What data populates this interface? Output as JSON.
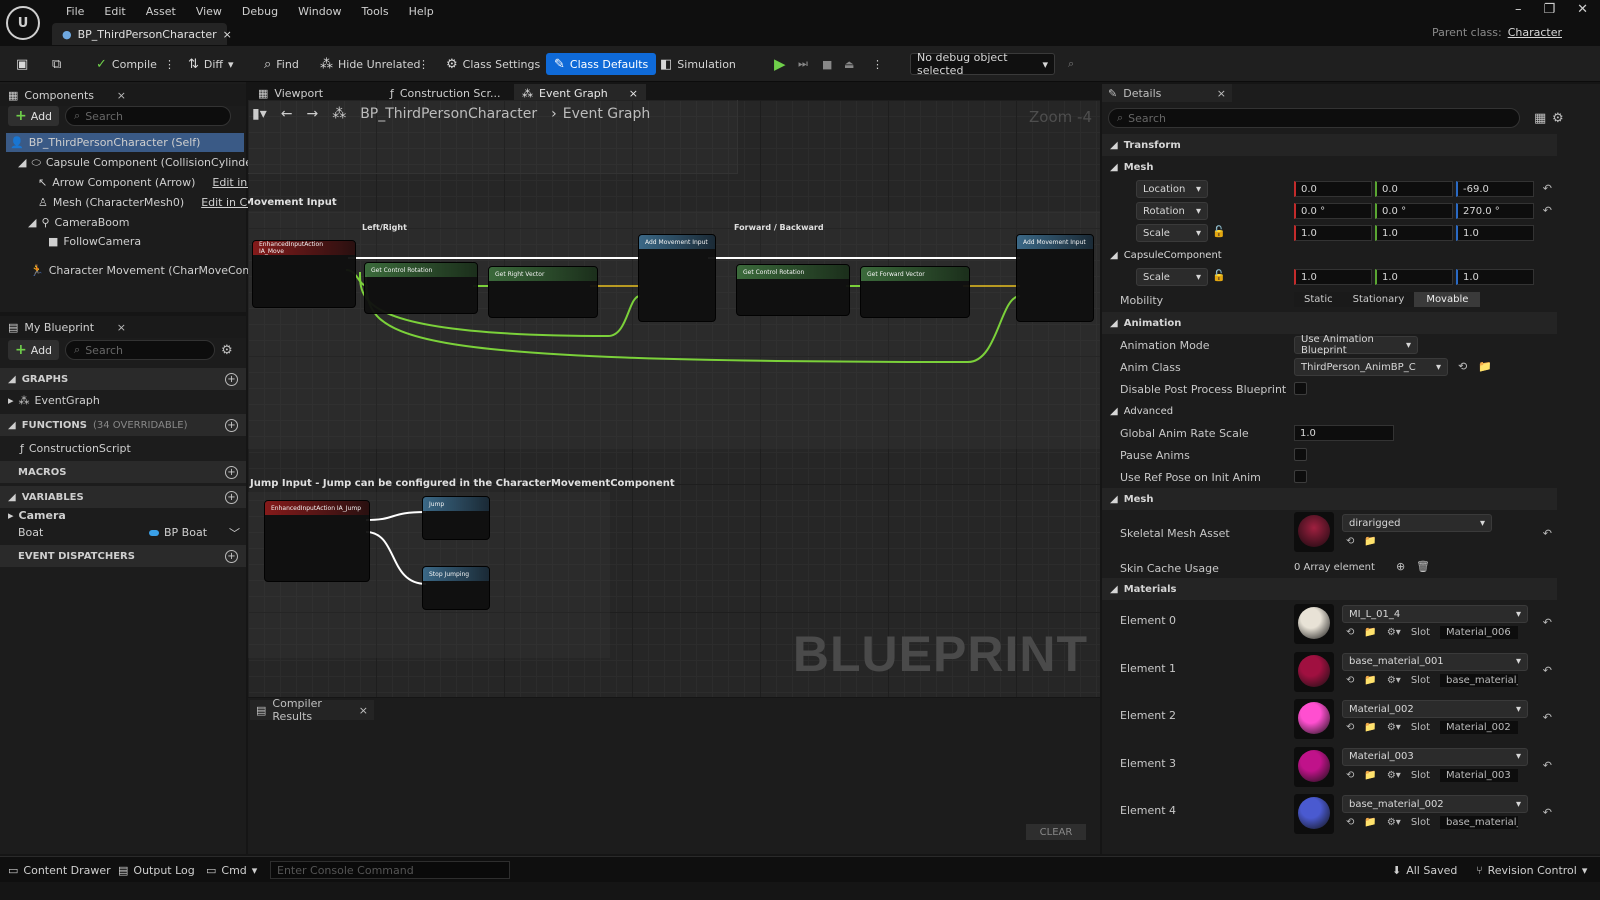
{
  "menu": [
    "File",
    "Edit",
    "Asset",
    "View",
    "Debug",
    "Window",
    "Tools",
    "Help"
  ],
  "doc_tab": "BP_ThirdPersonCharacter",
  "parent_class": {
    "label": "Parent class:",
    "value": "Character"
  },
  "toolbar": {
    "compile": "Compile",
    "diff": "Diff",
    "find": "Find",
    "hide_unrelated": "Hide Unrelated",
    "class_settings": "Class Settings",
    "class_defaults": "Class Defaults",
    "simulation": "Simulation",
    "debug_object": "No debug object selected"
  },
  "components": {
    "title": "Components",
    "add": "Add",
    "search_placeholder": "Search",
    "items": [
      "BP_ThirdPersonCharacter (Self)",
      "Capsule Component (CollisionCylinder)",
      "Arrow Component (Arrow)",
      "Mesh (CharacterMesh0)",
      "CameraBoom",
      "FollowCamera",
      "Character Movement (CharMoveComp)"
    ],
    "edit_cpp": "Edit in C++"
  },
  "my_blueprint": {
    "title": "My Blueprint",
    "add": "Add",
    "search_placeholder": "Search",
    "graphs": "GRAPHS",
    "event_graph": "EventGraph",
    "functions": "FUNCTIONS",
    "functions_count": "(34 OVERRIDABLE)",
    "construction_script": "ConstructionScript",
    "macros": "MACROS",
    "variables": "VARIABLES",
    "camera": "Camera",
    "var_boat": "Boat",
    "var_boat_type": "BP Boat",
    "event_dispatchers": "EVENT DISPATCHERS"
  },
  "graph_tabs": [
    "Viewport",
    "Construction Scr...",
    "Event Graph"
  ],
  "graph": {
    "breadcrumb_root": "BP_ThirdPersonCharacter",
    "breadcrumb_leaf": "Event Graph",
    "zoom": "Zoom -4",
    "comment_move": "Movement Input",
    "comment_lr": "Left/Right",
    "comment_fb": "Forward / Backward",
    "comment_jump": "Jump Input - Jump can be configured in the CharacterMovementComponent",
    "watermark": "BLUEPRINT",
    "nodes": {
      "ia_move": "EnhancedInputAction IA_Move",
      "get_control_rotation": "Get Control Rotation",
      "get_right_vector": "Get Right Vector",
      "add_movement_input": "Add Movement Input",
      "get_forward_vector": "Get Forward Vector",
      "ia_jump": "EnhancedInputAction IA_Jump",
      "jump": "Jump",
      "stop_jumping": "Stop Jumping"
    }
  },
  "compiler": {
    "title": "Compiler Results",
    "clear": "CLEAR"
  },
  "details": {
    "title": "Details",
    "search_placeholder": "Search",
    "transform": "Transform",
    "mesh": "Mesh",
    "location": "Location",
    "rotation": "Rotation",
    "scale": "Scale",
    "loc": [
      "0.0",
      "0.0",
      "-69.0"
    ],
    "rot": [
      "0.0 °",
      "0.0 °",
      "270.0 °"
    ],
    "scl": [
      "1.0",
      "1.0",
      "1.0"
    ],
    "capsule": "CapsuleComponent",
    "cap_scale": [
      "1.0",
      "1.0",
      "1.0"
    ],
    "mobility": "Mobility",
    "mob_opts": [
      "Static",
      "Stationary",
      "Movable"
    ],
    "animation": "Animation",
    "anim_mode": "Animation Mode",
    "anim_mode_val": "Use Animation Blueprint",
    "anim_class": "Anim Class",
    "anim_class_val": "ThirdPerson_AnimBP_C",
    "disable_pp": "Disable Post Process Blueprint",
    "advanced": "Advanced",
    "global_rate": "Global Anim Rate Scale",
    "global_rate_val": "1.0",
    "pause_anims": "Pause Anims",
    "use_ref_pose": "Use Ref Pose on Init Anim",
    "mesh2": "Mesh",
    "skel_mesh": "Skeletal Mesh Asset",
    "skel_mesh_val": "dirarigged",
    "skin_cache": "Skin Cache Usage",
    "skin_cache_val": "0 Array element",
    "materials": "Materials",
    "slot": "Slot",
    "elements": [
      {
        "label": "Element 0",
        "mat": "MI_L_01_4",
        "slot": "Material_006",
        "color": "#e8e2d6"
      },
      {
        "label": "Element 1",
        "mat": "base_material_001",
        "slot": "base_material_(",
        "color": "#a01040"
      },
      {
        "label": "Element 2",
        "mat": "Material_002",
        "slot": "Material_002",
        "color": "#ff4fd0"
      },
      {
        "label": "Element 3",
        "mat": "Material_003",
        "slot": "Material_003",
        "color": "#c0128a"
      },
      {
        "label": "Element 4",
        "mat": "base_material_002",
        "slot": "base_material_(",
        "color": "#4a5ad0"
      }
    ]
  },
  "bottom": {
    "content_drawer": "Content Drawer",
    "output_log": "Output Log",
    "cmd": "Cmd",
    "console_placeholder": "Enter Console Command",
    "all_saved": "All Saved",
    "revision": "Revision Control"
  }
}
